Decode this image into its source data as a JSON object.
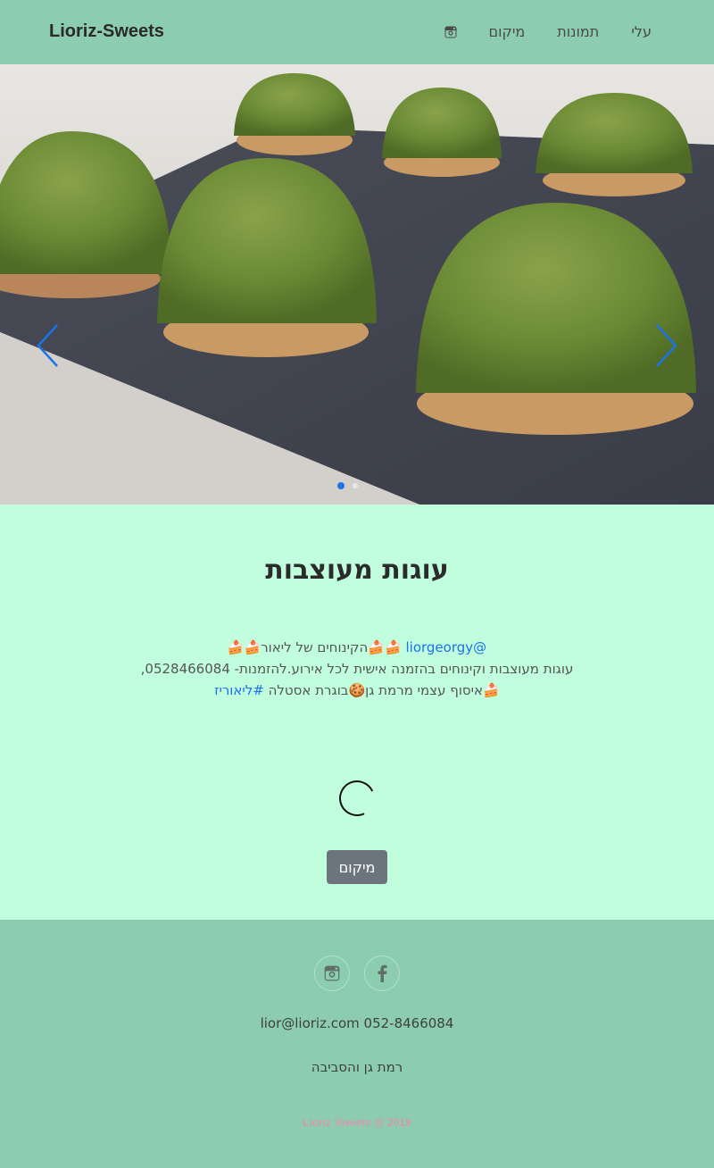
{
  "navbar": {
    "brand": "Lioriz-Sweets",
    "links": [
      {
        "label": "עלי"
      },
      {
        "label": "תמונות"
      },
      {
        "label": "מיקום"
      }
    ],
    "instagram_icon": "instagram-icon"
  },
  "carousel": {
    "image_description": "green pastry puffs on slate board",
    "prev_icon": "chevron-left-icon",
    "next_icon": "chevron-right-icon",
    "active_index": 0,
    "slide_count": 2,
    "accent": "#1a73e8"
  },
  "main": {
    "title": "עוגות מעוצבות",
    "bio_line1_link": "@liorgeorgy",
    "bio_line1_text": " 🍰🍰הקינוחים של ליאור🍰🍰",
    "bio_line2": "עוגות מעוצבות וקינוחים בהזמנה אישית לכל אירוע.להזמנות- 0528466084,",
    "bio_line3_text": "🍰איסוף עצמי מרמת גן🍪בוגרת אסטלה ",
    "bio_line3_link": "#ליאוריז",
    "location_button": "מיקום"
  },
  "footer": {
    "social": [
      "facebook-icon",
      "instagram-icon"
    ],
    "contact": "lior@lioriz.com 052-8466084",
    "address": "רמת גן והסביבה",
    "copyright": "Lioriz Sweets @ 2019"
  },
  "colors": {
    "navbar_bg": "#8ccdaf",
    "page_bg": "#c0fede",
    "button_bg": "#6c757d",
    "link": "#1a73e8"
  }
}
